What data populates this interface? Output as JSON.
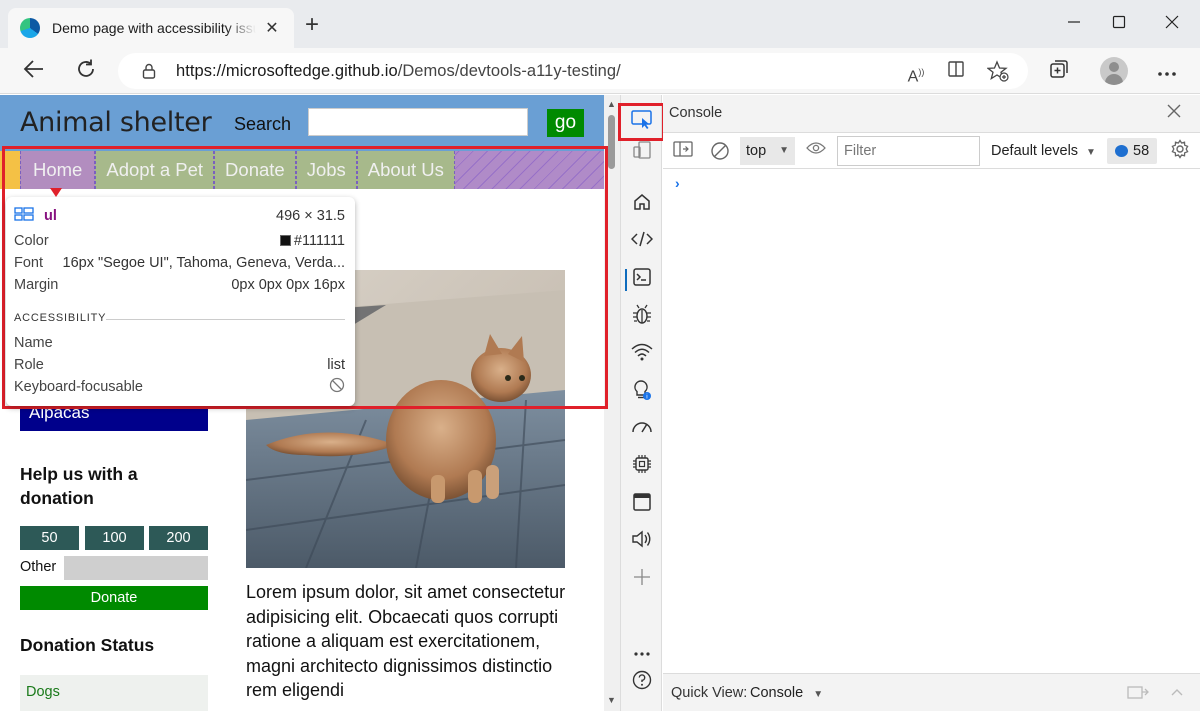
{
  "browser": {
    "tab_title": "Demo page with accessibility issues",
    "new_tab_symbol": "+",
    "tab_close_symbol": "✕",
    "url_host": "https://microsoftedge.github.io",
    "url_path": "/Demos/devtools-a11y-testing/"
  },
  "page": {
    "site_title": "Animal shelter",
    "search_label": "Search",
    "search_button": "go",
    "nav_links": [
      "Home",
      "Adopt a Pet",
      "Donate",
      "Jobs",
      "About Us"
    ],
    "sidebar_item": "Alpacas",
    "help_title": "Help us with a donation",
    "amounts": [
      "50",
      "100",
      "200"
    ],
    "other_label": "Other",
    "donate_button": "Donate",
    "status_title": "Donation Status",
    "status_first_row": "Dogs",
    "lorem": "Lorem ipsum dolor, sit amet consectetur adipisicing elit. Obcaecati quos corrupti ratione a aliquam est exercitationem, magni architecto dignissimos distinctio rem eligendi"
  },
  "inspect_tooltip": {
    "tag": "ul",
    "size": "496 × 31.5",
    "color_label": "Color",
    "color_value": "#111111",
    "font_label": "Font",
    "font_value": "16px \"Segoe UI\", Tahoma, Geneva, Verda...",
    "margin_label": "Margin",
    "margin_value": "0px 0px 0px 16px",
    "section": "ACCESSIBILITY",
    "name_label": "Name",
    "name_value": "",
    "role_label": "Role",
    "role_value": "list",
    "focusable_label": "Keyboard-focusable"
  },
  "devtools": {
    "panel_title": "Console",
    "context": "top",
    "filter_placeholder": "Filter",
    "levels": "Default levels",
    "message_count": "58",
    "prompt": "›",
    "quick_view_label": "Quick View:",
    "quick_view_value": "Console"
  },
  "colors": {
    "header_blue": "#6a9fd4",
    "accent_green": "#008a00",
    "highlight_red": "#e0202a",
    "alpacas_blue": "#00008b",
    "amount_teal": "#2d5957"
  }
}
